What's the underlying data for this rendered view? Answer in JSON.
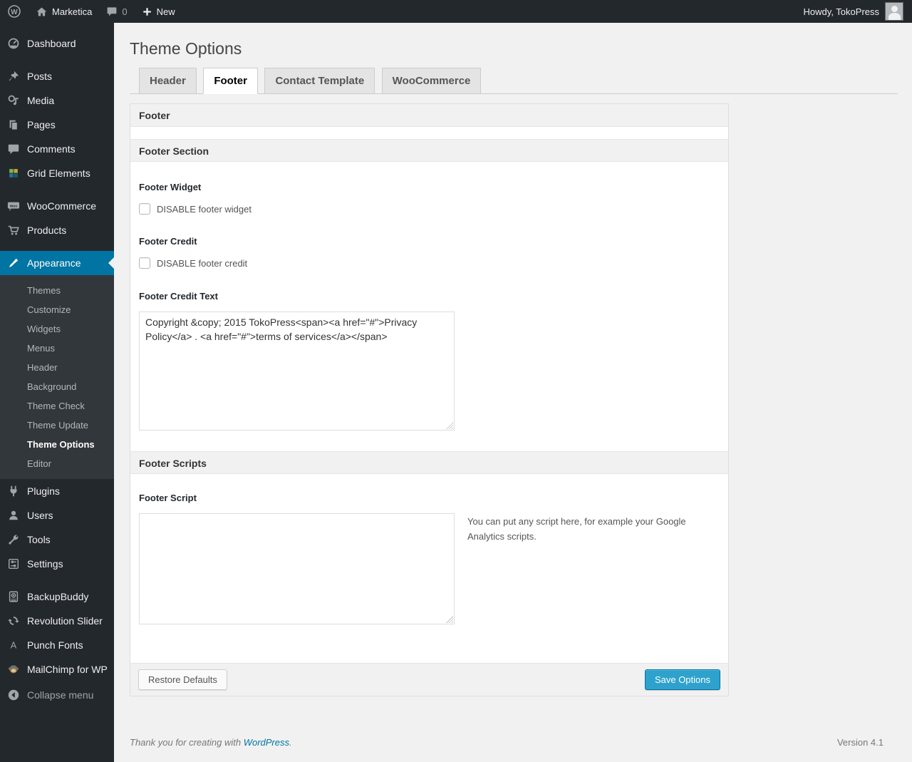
{
  "admin_bar": {
    "site_name": "Marketica",
    "comment_count": "0",
    "new_label": "New",
    "howdy": "Howdy, TokoPress"
  },
  "sidebar": {
    "items": [
      {
        "label": "Dashboard",
        "icon": "dashboard-icon"
      },
      {
        "label": "Posts",
        "icon": "pin-icon"
      },
      {
        "label": "Media",
        "icon": "media-icon"
      },
      {
        "label": "Pages",
        "icon": "pages-icon"
      },
      {
        "label": "Comments",
        "icon": "comment-icon"
      },
      {
        "label": "Grid Elements",
        "icon": "grid-elements-icon"
      },
      {
        "label": "WooCommerce",
        "icon": "woocommerce-icon"
      },
      {
        "label": "Products",
        "icon": "cart-icon"
      },
      {
        "label": "Appearance",
        "icon": "brush-icon"
      },
      {
        "label": "Plugins",
        "icon": "plug-icon"
      },
      {
        "label": "Users",
        "icon": "user-icon"
      },
      {
        "label": "Tools",
        "icon": "wrench-icon"
      },
      {
        "label": "Settings",
        "icon": "sliders-icon"
      },
      {
        "label": "BackupBuddy",
        "icon": "backup-icon"
      },
      {
        "label": "Revolution Slider",
        "icon": "refresh-icon"
      },
      {
        "label": "Punch Fonts",
        "icon": "letter-a-icon"
      },
      {
        "label": "MailChimp for WP",
        "icon": "monkey-icon"
      }
    ],
    "submenu": [
      {
        "label": "Themes"
      },
      {
        "label": "Customize"
      },
      {
        "label": "Widgets"
      },
      {
        "label": "Menus"
      },
      {
        "label": "Header"
      },
      {
        "label": "Background"
      },
      {
        "label": "Theme Check"
      },
      {
        "label": "Theme Update"
      },
      {
        "label": "Theme Options"
      },
      {
        "label": "Editor"
      }
    ],
    "collapse_label": "Collapse menu"
  },
  "page": {
    "title": "Theme Options",
    "tabs": [
      {
        "label": "Header",
        "active": false
      },
      {
        "label": "Footer",
        "active": true
      },
      {
        "label": "Contact Template",
        "active": false
      },
      {
        "label": "WooCommerce",
        "active": false
      }
    ]
  },
  "panel": {
    "header": "Footer",
    "section_header": "Footer Section",
    "footer_widget": {
      "label": "Footer Widget",
      "checkbox_label": "DISABLE footer widget",
      "checked": false
    },
    "footer_credit": {
      "label": "Footer Credit",
      "checkbox_label": "DISABLE footer credit",
      "checked": false
    },
    "footer_credit_text": {
      "label": "Footer Credit Text",
      "value": "Copyright &copy; 2015 TokoPress<span><a href=\"#\">Privacy Policy</a> . <a href=\"#\">terms of services</a></span>"
    },
    "scripts_header": "Footer Scripts",
    "footer_script": {
      "label": "Footer Script",
      "value": "",
      "description": "You can put any script here, for example your Google Analytics scripts."
    },
    "buttons": {
      "restore": "Restore Defaults",
      "save": "Save Options"
    }
  },
  "footer": {
    "thanks_prefix": "Thank you for creating with ",
    "wordpress_link": "WordPress",
    "thanks_suffix": ".",
    "version": "Version 4.1"
  },
  "colors": {
    "accent": "#0074a2",
    "primary_button": "#2ea2cc",
    "admin_bg": "#23282d",
    "submenu_bg": "#32373c",
    "page_bg": "#f1f1f1"
  }
}
